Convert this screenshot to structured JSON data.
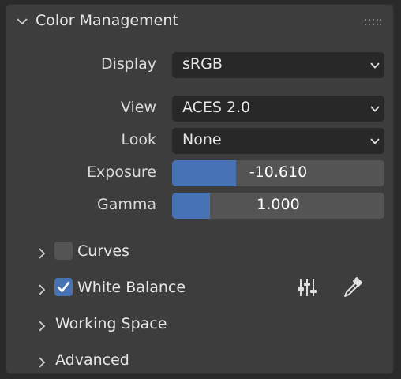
{
  "panel": {
    "title": "Color Management",
    "header_icon": "chevron-down-icon",
    "grip_icon": "drag-grip-icon"
  },
  "fields": {
    "display": {
      "label": "Display",
      "value": "sRGB"
    },
    "view": {
      "label": "View",
      "value": "ACES 2.0"
    },
    "look": {
      "label": "Look",
      "value": "None"
    },
    "exposure": {
      "label": "Exposure",
      "value": "-10.610",
      "fill_fraction": 0.3
    },
    "gamma": {
      "label": "Gamma",
      "value": "1.000",
      "fill_fraction": 0.18
    }
  },
  "subpanels": {
    "curves": {
      "label": "Curves",
      "checked": false
    },
    "white_balance": {
      "label": "White Balance",
      "checked": true,
      "icons": [
        "sliders-icon",
        "eyedropper-icon"
      ]
    },
    "working_space": {
      "label": "Working Space"
    },
    "advanced": {
      "label": "Advanced"
    }
  },
  "colors": {
    "accent": "#4772b3",
    "panel_bg": "#3d3d3d",
    "field_bg": "#282828",
    "slider_bg": "#545454"
  }
}
